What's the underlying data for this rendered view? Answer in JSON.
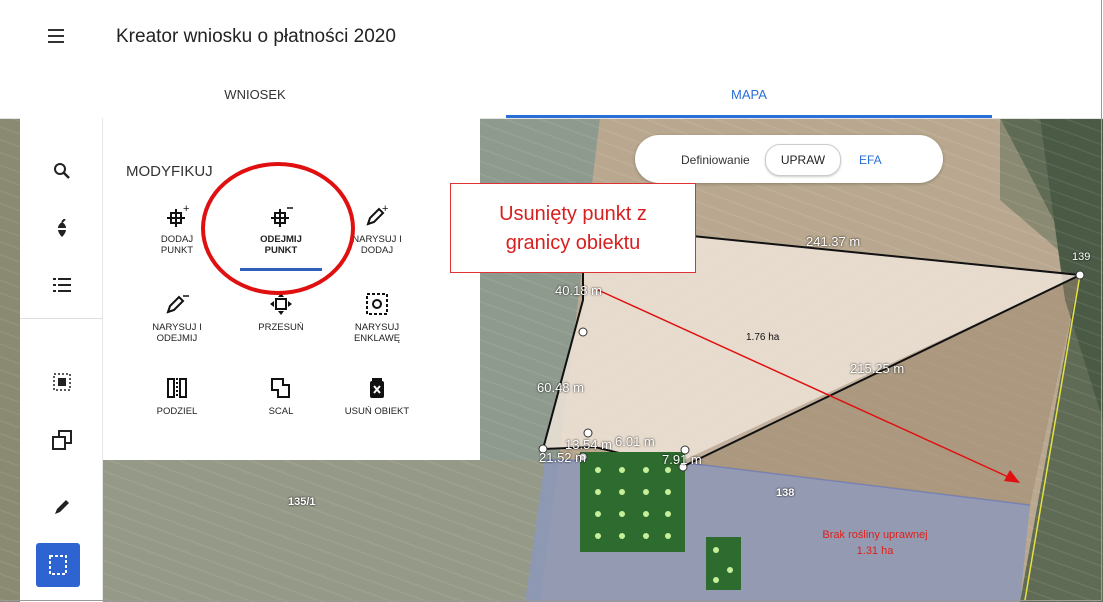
{
  "header": {
    "title": "Kreator wniosku o płatności 2020"
  },
  "tabs": [
    {
      "label": "WNIOSEK",
      "active": false
    },
    {
      "label": "MAPA",
      "active": true
    }
  ],
  "sidebar": {
    "icons": [
      "search-icon",
      "crop-icon",
      "list-icon",
      "select-area-icon",
      "copy-icon",
      "pencil-icon",
      "modify-frame-icon"
    ],
    "active_index": 6,
    "accent": "#2e64d2"
  },
  "panel": {
    "title": "MODYFIKUJ",
    "tools": [
      {
        "label1": "DODAJ",
        "label2": "PUNKT",
        "icon": "add-point-icon"
      },
      {
        "label1": "ODEJMIJ",
        "label2": "PUNKT",
        "icon": "remove-point-icon",
        "active": true
      },
      {
        "label1": "NARYSUJ I",
        "label2": "DODAJ",
        "icon": "draw-add-icon"
      },
      {
        "label1": "NARYSUJ I",
        "label2": "ODEJMIJ",
        "icon": "draw-subtract-icon"
      },
      {
        "label1": "PRZESUŃ",
        "label2": "",
        "icon": "move-icon"
      },
      {
        "label1": "NARYSUJ",
        "label2": "ENKLAWĘ",
        "icon": "enclave-icon"
      },
      {
        "label1": "PODZIEL",
        "label2": "",
        "icon": "split-icon"
      },
      {
        "label1": "SCAL",
        "label2": "",
        "icon": "merge-icon"
      },
      {
        "label1": "USUŃ OBIEKT",
        "label2": "",
        "icon": "delete-object-icon"
      }
    ]
  },
  "toggle": {
    "label": "Definiowanie",
    "option_active": "UPRAW",
    "option_other": "EFA"
  },
  "annotation": {
    "line1": "Usunięty punkt z",
    "line2": "granicy obiektu",
    "color": "#d81f1f"
  },
  "map": {
    "labels": {
      "top_edge": "241.37 m",
      "left_edge": "40.18 m",
      "area_main": "1.76 ha",
      "diag_edge": "215.25 m",
      "left_lower": "60.48 m",
      "corner_139": "139",
      "seg_a": "13.54 m",
      "seg_b": "6.01 m",
      "seg_c": "21.52 m",
      "seg_d": "7.91 m",
      "parcel_1351": "135/1",
      "parcel_138": "138",
      "brak_line1": "Brak rośliny uprawnej",
      "brak_line2": "1.31 ha"
    }
  }
}
